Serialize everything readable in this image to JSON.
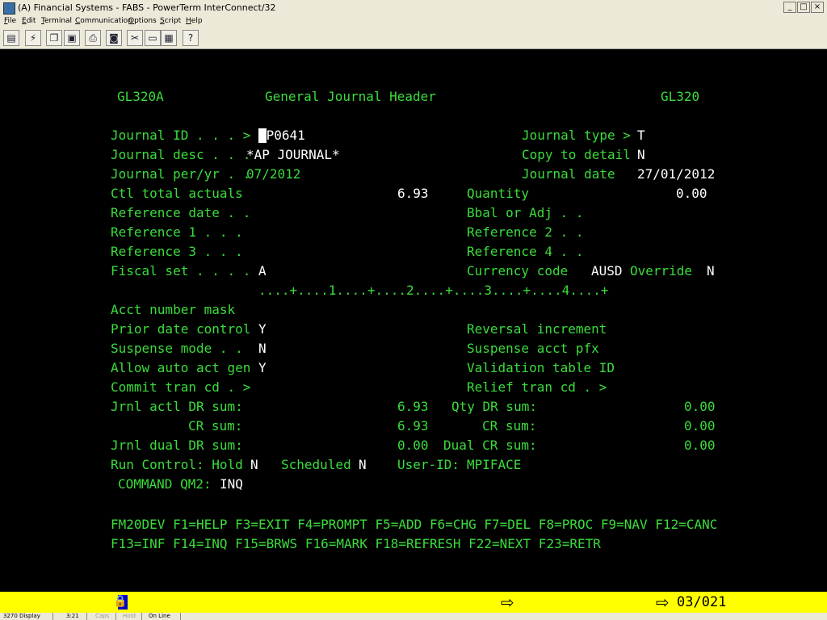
{
  "window": {
    "title": "(A) Financial Systems - FABS - PowerTerm InterConnect/32",
    "min_label": "_",
    "max_label": "□",
    "close_label": "×"
  },
  "menu": [
    "File",
    "Edit",
    "Terminal",
    "Communication",
    "Options",
    "Script",
    "Help"
  ],
  "toolbar_icons": [
    "terminal-icon",
    "connect-icon",
    "copy-icon",
    "paste-icon",
    "print-icon",
    "camera-icon",
    "tools-icon",
    "keyboard-icon",
    "grid-icon",
    "help-icon"
  ],
  "screen": {
    "header": {
      "left": "GL320A",
      "center": "General Journal Header",
      "right": "GL320"
    },
    "rows": [
      {
        "label": "Journal ID . . . >",
        "value": "AP0641",
        "rlabel": "Journal type >",
        "rvalue": "T"
      },
      {
        "label": "Journal desc . . .",
        "value": "*AP JOURNAL*",
        "rlabel": "Copy to detail",
        "rvalue": "N"
      },
      {
        "label": "Journal per/yr . .",
        "value": "07/2012",
        "rlabel": "Journal date",
        "rvalue": "27/01/2012"
      }
    ],
    "ctl_total": {
      "label": "Ctl total actuals",
      "value": "6.93",
      "qty_label": "Quantity",
      "qty_value": "0.00"
    },
    "ref_date": {
      "label": "Reference date . .",
      "rlabel": "Bbal or Adj . ."
    },
    "ref1": {
      "label": "Reference 1 . . .",
      "rlabel": "Reference 2 . ."
    },
    "ref3": {
      "label": "Reference 3 . . .",
      "rlabel": "Reference 4 . ."
    },
    "fiscal": {
      "label": "Fiscal set . . . .",
      "value": "A",
      "cur_label": "Currency code",
      "cur_value": "AUSD",
      "ovr_label": "Override",
      "ovr_value": "N"
    },
    "ruler": "....+....1....+....2....+....3....+....4....+",
    "mask_label": "Acct number mask",
    "prior": {
      "label": "Prior date control",
      "value": "Y",
      "rlabel": "Reversal increment"
    },
    "suspense": {
      "label": "Suspense mode . .",
      "value": "N",
      "rlabel": "Suspense acct pfx"
    },
    "auto": {
      "label": "Allow auto act gen",
      "value": "Y",
      "rlabel": "Validation table ID"
    },
    "commit": {
      "label": "Commit tran cd . >",
      "rlabel": "Relief tran cd . >"
    },
    "actl_dr": {
      "label": "Jrnl actl DR sum:",
      "value": "6.93",
      "qlabel": "Qty DR sum:",
      "qvalue": "0.00"
    },
    "actl_cr": {
      "label": "CR sum:",
      "value": "6.93",
      "qlabel": "CR sum:",
      "qvalue": "0.00"
    },
    "dual": {
      "label": "Jrnl dual DR sum:",
      "value": "0.00",
      "qlabel": "Dual CR sum:",
      "qvalue": "0.00"
    },
    "run": {
      "label": "Run Control: Hold",
      "hold": "N",
      "sched_label": "Scheduled",
      "sched": "N",
      "user_label": "User-ID:",
      "user": "MPIFACE"
    },
    "command": {
      "label": "COMMAND QM2:",
      "value": "INQ"
    },
    "fkeys1": "FM20DEV F1=HELP F3=EXIT F4=PROMPT F5=ADD F6=CHG F7=DEL F8=PROC F9=NAV F12=CANC",
    "fkeys2": "F13=INF F14=INQ F15=BRWS F16=MARK F18=REFRESH F22=NEXT F23=RETR"
  },
  "oia": {
    "lock_symbol": "🔒",
    "arrow": "⇨",
    "position": "03/021"
  },
  "status": [
    "3270 Display",
    "3:21",
    "Caps",
    "Hold",
    "On Line"
  ]
}
